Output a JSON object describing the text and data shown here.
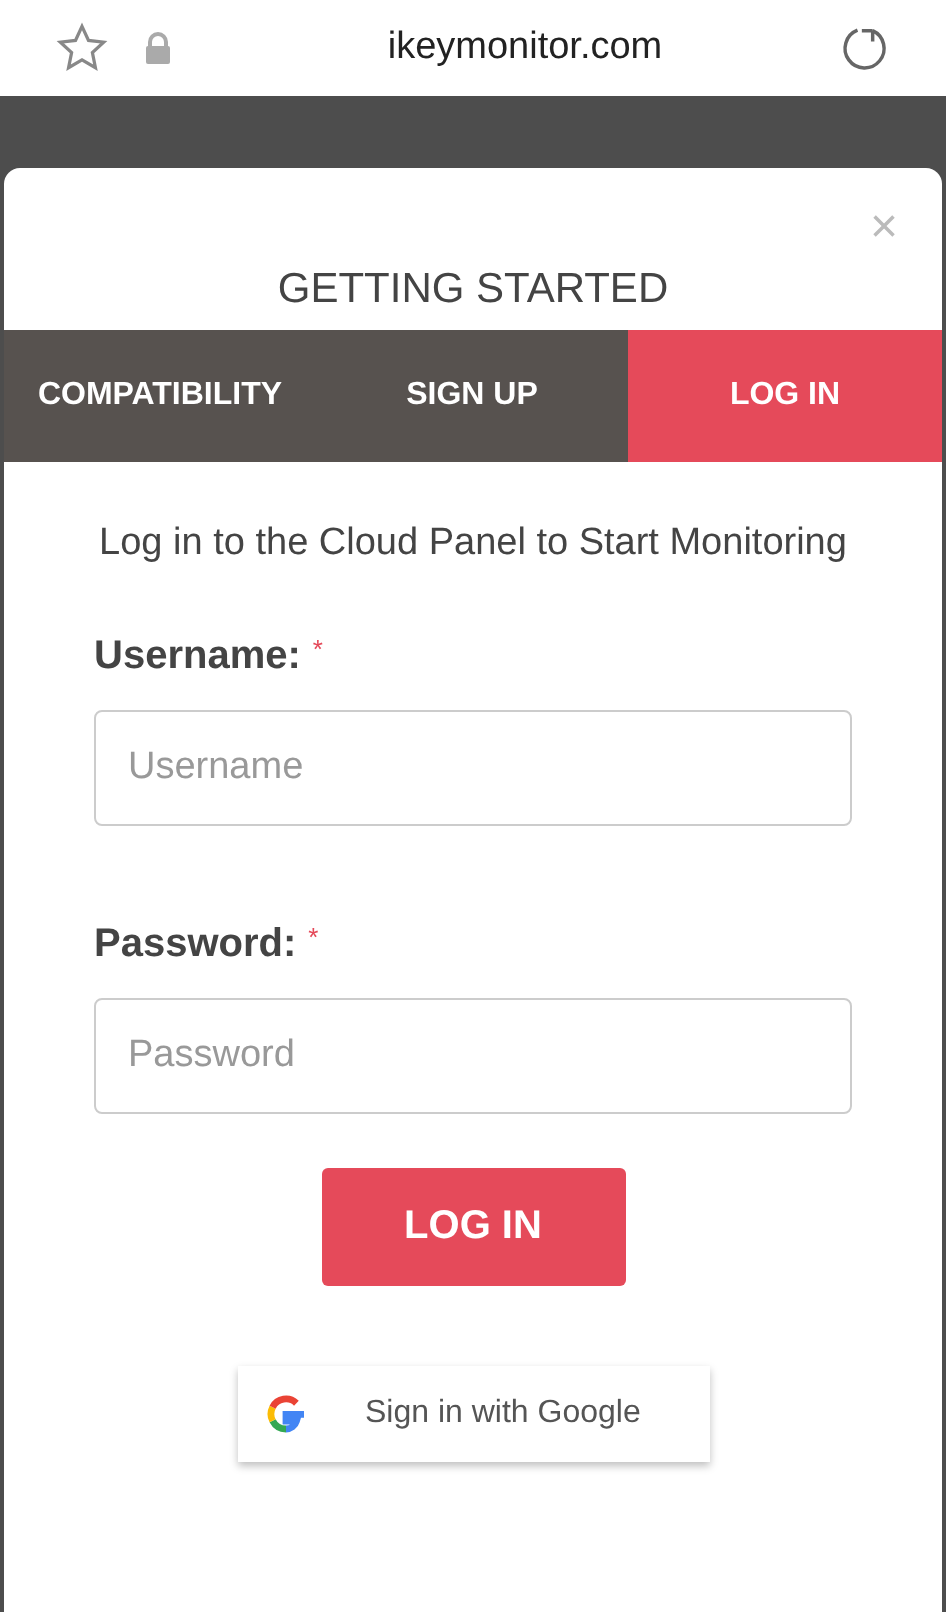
{
  "browser": {
    "url": "ikeymonitor.com"
  },
  "modal": {
    "title": "GETTING STARTED",
    "close": "×"
  },
  "tabs": [
    {
      "label": "COMPATIBILITY",
      "selected": false
    },
    {
      "label": "SIGN UP",
      "selected": false
    },
    {
      "label": "LOG IN",
      "selected": true
    }
  ],
  "heading": "Log in to the Cloud Panel to Start Monitoring",
  "fields": [
    {
      "label": "Username:",
      "required_mark": "*",
      "placeholder": "Username"
    },
    {
      "label": "Password:",
      "required_mark": "*",
      "placeholder": "Password"
    }
  ],
  "login_button": "LOG IN",
  "google_button": "Sign in with Google"
}
